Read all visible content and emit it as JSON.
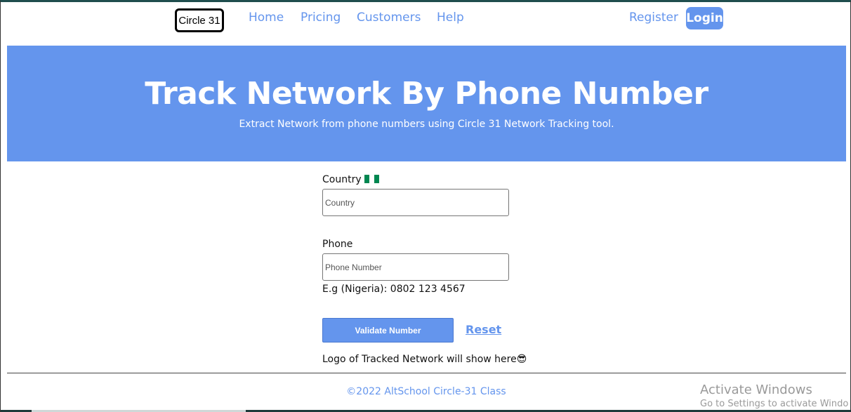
{
  "nav": {
    "logo": "Circle 31",
    "links": [
      "Home",
      "Pricing",
      "Customers",
      "Help"
    ],
    "register": "Register",
    "login": "Login"
  },
  "hero": {
    "title": "Track Network By Phone Number",
    "subtitle": "Extract Network from phone numbers using Circle 31 Network Tracking tool."
  },
  "form": {
    "country_label": "Country",
    "country_placeholder": "Country",
    "phone_label": "Phone",
    "phone_placeholder": "Phone Number",
    "phone_hint": "E.g (Nigeria): 0802 123 4567",
    "validate_label": "Validate Number",
    "reset_label": "Reset",
    "logo_note": "Logo of Tracked Network will show here",
    "logo_note_emoji": "😎"
  },
  "footer": {
    "text": "©2022 AltSchool Circle-31 Class"
  },
  "watermark": {
    "title": "Activate Windows",
    "subtitle": "Go to Settings to activate Windo"
  },
  "colors": {
    "accent": "#6495ed",
    "flag_green": "#008751",
    "flag_white": "#ffffff"
  },
  "icons": {
    "country_flag": "nigeria-flag-icon",
    "emoji": "sunglasses-emoji-icon"
  }
}
